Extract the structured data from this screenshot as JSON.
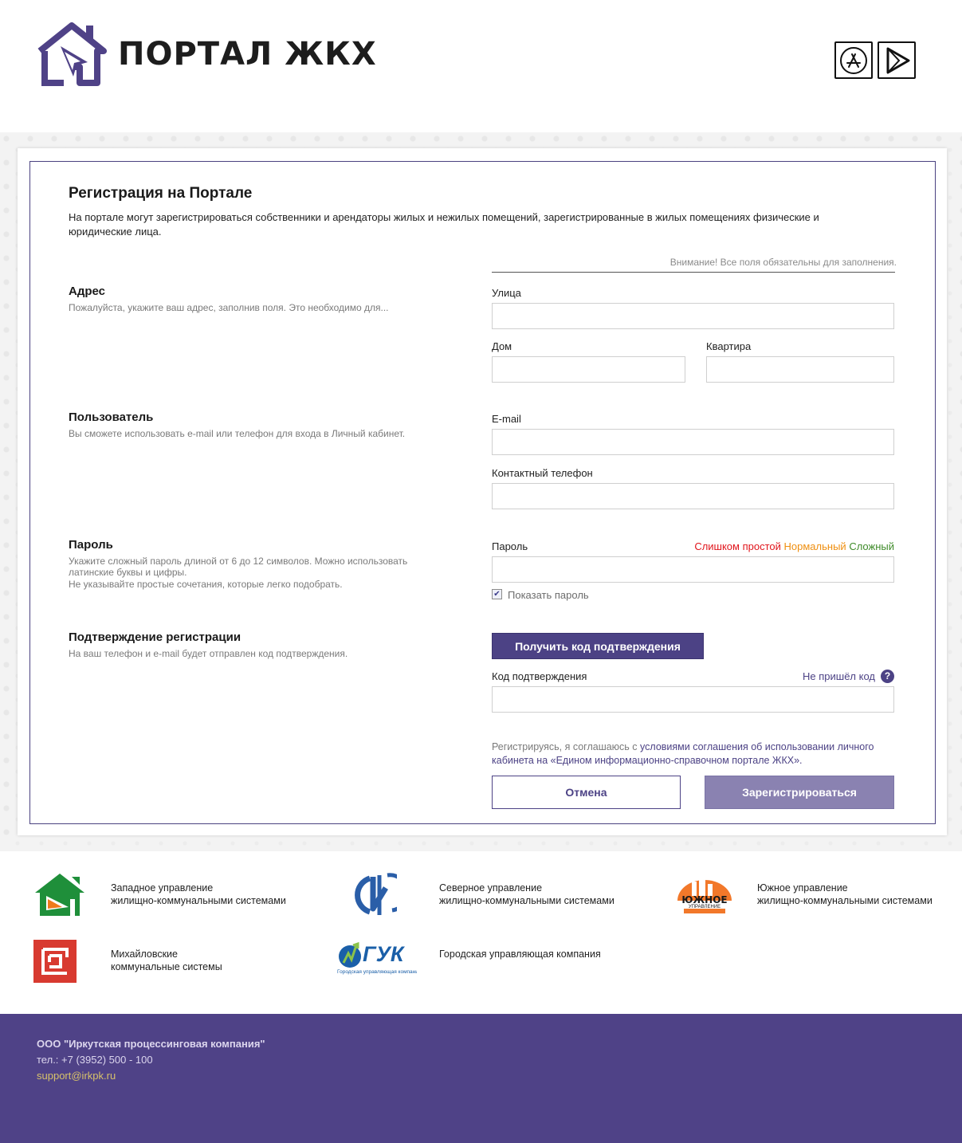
{
  "header": {
    "logo_text": "ПОРТАЛ ЖКХ",
    "app_store_icon": "app-store-icon",
    "google_play_icon": "google-play-icon"
  },
  "form": {
    "title": "Регистрация на Портале",
    "intro": "На портале могут зарегистрироваться собственники и арендаторы жилых и нежилых помещений, зарегистрированные в жилых помещениях физические и юридические лица.",
    "notice": "Внимание! Все поля обязательны для заполнения.",
    "address": {
      "title": "Адрес",
      "description": "Пожалуйста, укажите ваш адрес, заполнив поля. Это необходимо для...",
      "street_label": "Улица",
      "street_value": "",
      "house_label": "Дом",
      "house_value": "",
      "apartment_label": "Квартира",
      "apartment_value": ""
    },
    "user": {
      "title": "Пользователь",
      "description": "Вы сможете использовать e-mail или телефон для входа в Личный кабинет.",
      "email_label": "E-mail",
      "email_value": "",
      "phone_label": "Контактный телефон",
      "phone_value": ""
    },
    "password": {
      "title": "Пароль",
      "description_1": "Укажите сложный пароль длиной от 6 до 12 символов. Можно использовать латинские буквы и цифры.",
      "description_2": "Не указывайте простые сочетания, которые легко подобрать.",
      "label": "Пароль",
      "value": "",
      "strength_weak": "Слишком простой",
      "strength_normal": "Нормальный",
      "strength_strong": "Сложный",
      "show_password_label": "Показать пароль",
      "show_password_checked": true
    },
    "confirm": {
      "title": "Подтверждение регистрации",
      "description": "На ваш телефон и e-mail будет отправлен код подтверждения.",
      "get_code_button": "Получить код подтверждения",
      "code_label": "Код подтверждения",
      "code_value": "",
      "no_code_link": "Не пришёл код",
      "help_icon_text": "?"
    },
    "agreement": {
      "prefix": "Регистрируясь, я соглашаюсь с ",
      "link": "условиями соглашения об использовании личного кабинета на «Едином информационно-справочном портале ЖКХ»",
      "suffix": "."
    },
    "cancel_button": "Отмена",
    "register_button": "Зарегистрироваться"
  },
  "partners": [
    {
      "line1": "Западное управление",
      "line2": "жилищно-коммунальными системами"
    },
    {
      "line1": "Северное управление",
      "line2": "жилищно-коммунальными системами"
    },
    {
      "line1": "Южное управление",
      "line2": "жилищно-коммунальными системами",
      "logo_text": "ЮЖНОЕ",
      "logo_subtext": "УПРАВЛЕНИЕ"
    },
    {
      "line1": "Михайловские",
      "line2": "коммунальные системы"
    },
    {
      "line1": "Городская управляющая компания",
      "line2": "",
      "logo_text": "ГУК",
      "logo_subtext": "Городская управляющая компания"
    }
  ],
  "footer": {
    "company": "ООО \"Иркутская процессинговая компания\"",
    "phone": "тел.: +7 (3952) 500 - 100",
    "email": "support@irkpk.ru"
  },
  "colors": {
    "brand": "#4f4287",
    "weak": "#e1151c",
    "normal": "#ef8f10",
    "strong": "#3f8b2a"
  }
}
